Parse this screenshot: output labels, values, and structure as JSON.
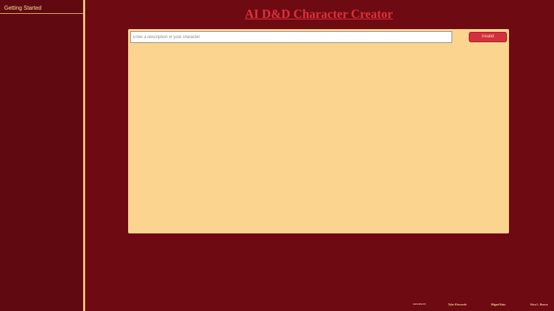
{
  "sidebar": {
    "items": [
      {
        "label": "Getting Started"
      }
    ]
  },
  "header": {
    "title": "AI D&D Character Creator"
  },
  "form": {
    "description_placeholder": "Enter a description of your character",
    "description_value": "",
    "submit_label": "Invalid"
  },
  "footer": {
    "created_by_label": "CREATED BY",
    "credits": [
      "Tyler Ebsworth",
      "Miguel Ruiz",
      "Kira L. Brown"
    ]
  },
  "colors": {
    "background": "#6e0a12",
    "sidebar": "#610910",
    "accent": "#f2c66a",
    "panel": "#fbd58f",
    "title": "#e0303b",
    "button": "#d2303e"
  }
}
